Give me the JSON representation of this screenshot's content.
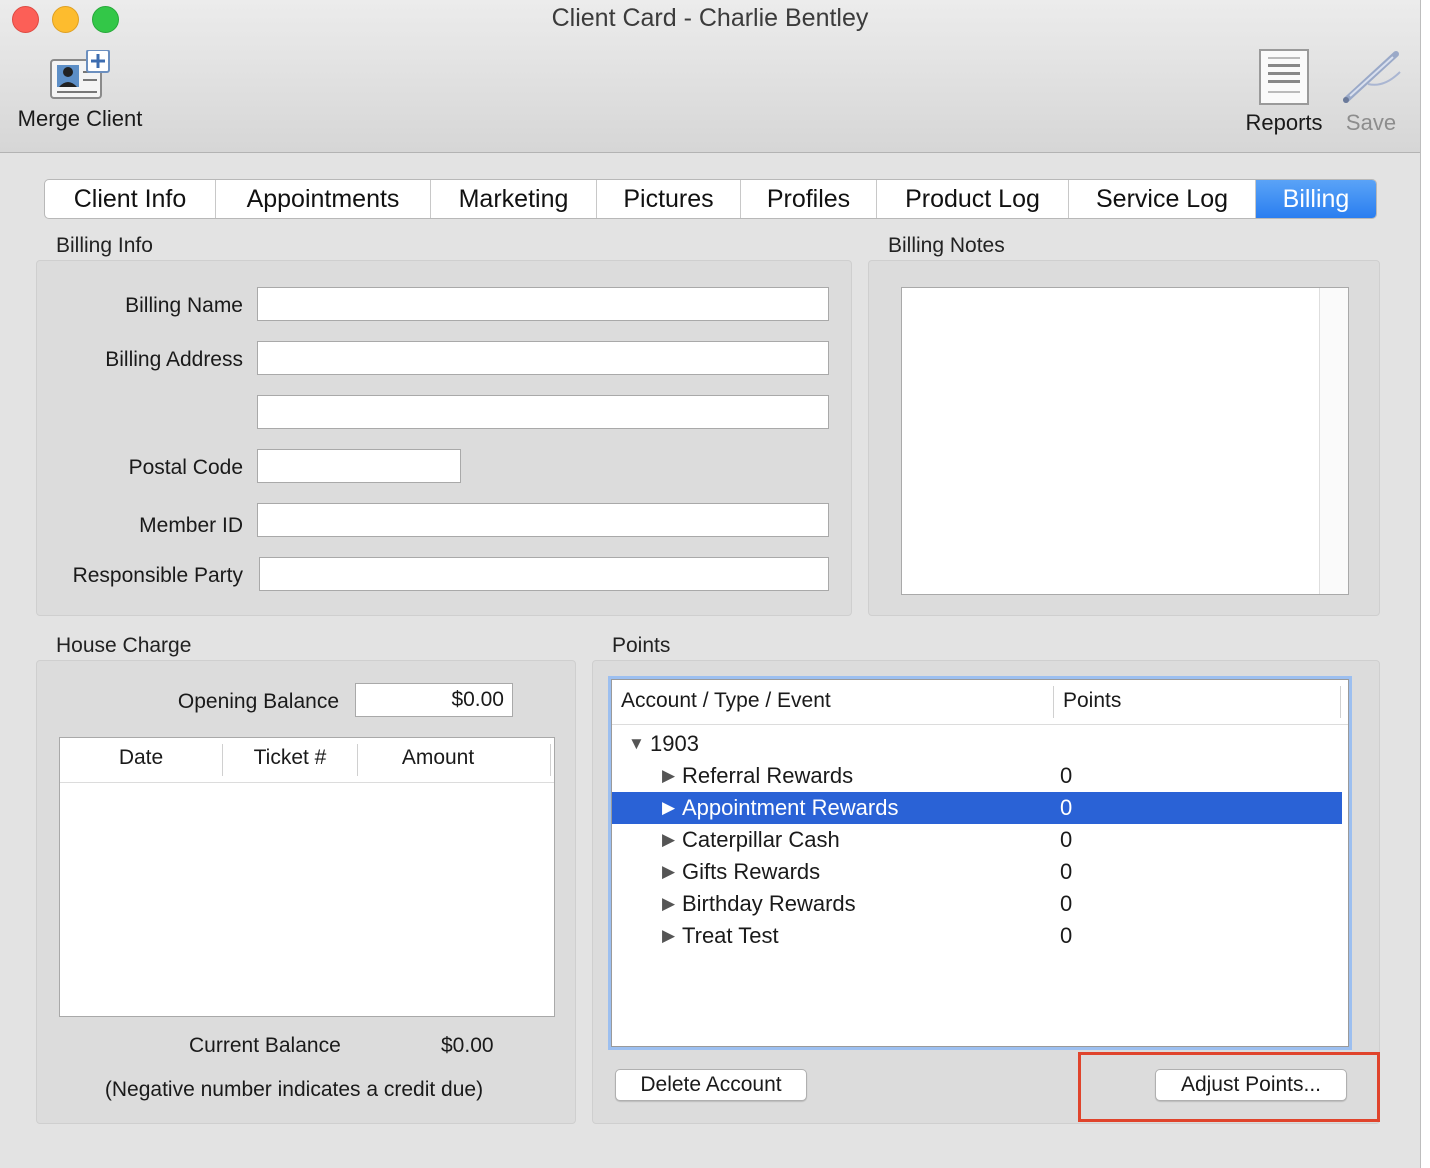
{
  "window": {
    "title": "Client Card - Charlie Bentley"
  },
  "toolbar": {
    "merge_label": "Merge Client",
    "reports_label": "Reports",
    "save_label": "Save"
  },
  "tabs": [
    {
      "label": "Client Info"
    },
    {
      "label": "Appointments"
    },
    {
      "label": "Marketing"
    },
    {
      "label": "Pictures"
    },
    {
      "label": "Profiles"
    },
    {
      "label": "Product Log"
    },
    {
      "label": "Service Log"
    },
    {
      "label": "Billing",
      "active": true
    }
  ],
  "billing_info": {
    "title": "Billing Info",
    "billing_name_label": "Billing Name",
    "billing_address_label": "Billing Address",
    "postal_code_label": "Postal Code",
    "member_id_label": "Member ID",
    "responsible_party_label": "Responsible Party",
    "billing_name": "",
    "address_line1": "",
    "address_line2": "",
    "postal_code": "",
    "member_id": "",
    "responsible_party": ""
  },
  "billing_notes": {
    "title": "Billing Notes",
    "text": ""
  },
  "house_charge": {
    "title": "House Charge",
    "opening_balance_label": "Opening Balance",
    "opening_balance": "$0.00",
    "columns": {
      "date": "Date",
      "ticket": "Ticket #",
      "amount": "Amount"
    },
    "current_balance_label": "Current Balance",
    "current_balance": "$0.00",
    "note": "(Negative number indicates a credit due)"
  },
  "points": {
    "title": "Points",
    "columns": {
      "account": "Account / Type / Event",
      "points": "Points"
    },
    "account": "1903",
    "rows": [
      {
        "name": "Referral Rewards",
        "points": "0"
      },
      {
        "name": "Appointment Rewards",
        "points": "0",
        "selected": true
      },
      {
        "name": "Caterpillar Cash",
        "points": "0"
      },
      {
        "name": "Gifts Rewards",
        "points": "0"
      },
      {
        "name": "Birthday Rewards",
        "points": "0"
      },
      {
        "name": "Treat Test",
        "points": "0"
      }
    ],
    "delete_label": "Delete Account",
    "adjust_label": "Adjust Points...",
    "highlight_color": "#e0442c"
  }
}
